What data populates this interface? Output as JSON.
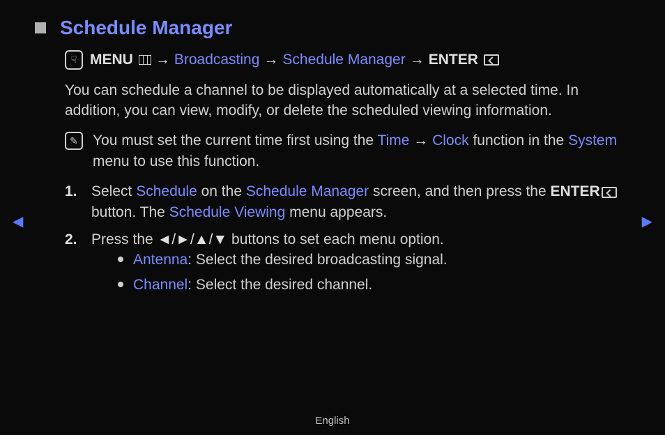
{
  "title": "Schedule Manager",
  "breadcrumb": {
    "menu": "MENU",
    "arrow": "→",
    "broadcasting": "Broadcasting",
    "schedule_manager": "Schedule Manager",
    "enter": "ENTER"
  },
  "body": {
    "intro": "You can schedule a channel to be displayed automatically at a selected time. In addition, you can view, modify, or delete the scheduled viewing information.",
    "note_pre": "You must set the current time first using the ",
    "note_time": "Time",
    "note_arrow": " → ",
    "note_clock": "Clock",
    "note_mid": " function in the ",
    "note_system": "System",
    "note_post": " menu to use this function."
  },
  "steps": {
    "s1_num": "1.",
    "s1_a": "Select ",
    "s1_schedule": "Schedule",
    "s1_b": " on the ",
    "s1_sm": "Schedule Manager",
    "s1_c": " screen, and then press the ",
    "s1_enter": "ENTER",
    "s1_d": " button. The ",
    "s1_sv": "Schedule Viewing",
    "s1_e": " menu appears.",
    "s2_num": "2.",
    "s2_a": "Press the ",
    "s2_arrows": "◄/►/▲/▼",
    "s2_b": " buttons to set each menu option.",
    "b1_label": "Antenna",
    "b1_text": ": Select the desired broadcasting signal.",
    "b2_label": "Channel",
    "b2_text": ": Select the desired channel."
  },
  "nav": {
    "left": "◀",
    "right": "▶"
  },
  "footer": "English"
}
